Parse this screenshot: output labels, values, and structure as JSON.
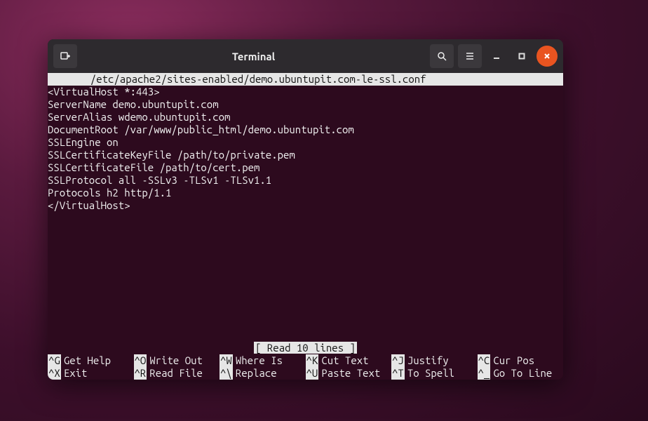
{
  "window": {
    "title": "Terminal"
  },
  "editor": {
    "filepath": "       /etc/apache2/sites-enabled/demo.ubuntupit.com-le-ssl.conf",
    "lines": [
      "<VirtualHost *:443>",
      "ServerName demo.ubuntupit.com",
      "ServerAlias wdemo.ubuntupit.com",
      "DocumentRoot /var/www/public_html/demo.ubuntupit.com",
      "SSLEngine on",
      "SSLCertificateKeyFile /path/to/private.pem",
      "SSLCertificateFile /path/to/cert.pem",
      "SSLProtocol all -SSLv3 -TLSv1 -TLSv1.1",
      "Protocols h2 http/1.1",
      "</VirtualHost>"
    ],
    "status": "[ Read 10 lines ]",
    "shortcuts": [
      {
        "key": "^G",
        "label": "Get Help"
      },
      {
        "key": "^O",
        "label": "Write Out"
      },
      {
        "key": "^W",
        "label": "Where Is"
      },
      {
        "key": "^K",
        "label": "Cut Text"
      },
      {
        "key": "^J",
        "label": "Justify"
      },
      {
        "key": "^C",
        "label": "Cur Pos"
      },
      {
        "key": "^X",
        "label": "Exit"
      },
      {
        "key": "^R",
        "label": "Read File"
      },
      {
        "key": "^\\",
        "label": "Replace"
      },
      {
        "key": "^U",
        "label": "Paste Text"
      },
      {
        "key": "^T",
        "label": "To Spell"
      },
      {
        "key": "^_",
        "label": "Go To Line"
      }
    ]
  }
}
